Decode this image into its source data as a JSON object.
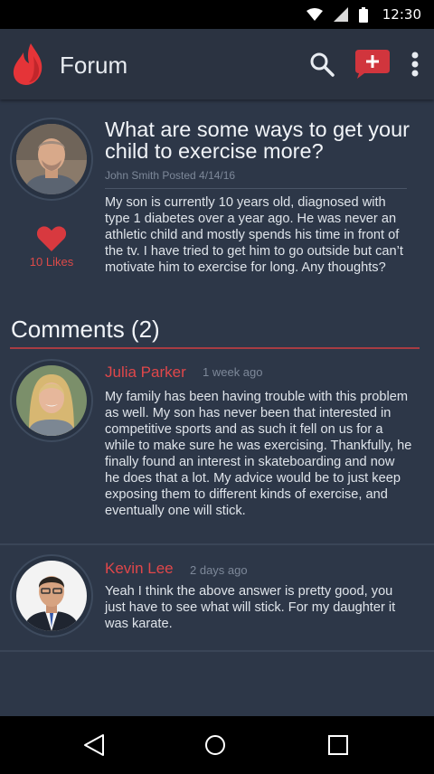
{
  "status_bar": {
    "time": "12:30",
    "icons": [
      "wifi-icon",
      "signal-icon",
      "battery-icon"
    ]
  },
  "app_bar": {
    "title": "Forum",
    "logo": "flame-logo",
    "actions": [
      "search-icon",
      "compose-icon",
      "more-vert-icon"
    ]
  },
  "question": {
    "title": "What are some ways to get your child to exercise more?",
    "author": "John Smith",
    "meta": "John Smith Posted 4/14/16",
    "body": "My son is currently 10 years old, diagnosed with type 1 diabetes over a year ago. He was never an athletic child and mostly spends his time in front of the tv. I have tried to get him to go outside but can’t motivate him to exercise for long. Any thoughts?",
    "likes_label": "10 Likes"
  },
  "comments": {
    "header": "Comments (2)",
    "items": [
      {
        "name": "Julia Parker",
        "time": "1 week ago",
        "body": "My family has been having trouble with this problem as well. My son has never been that interested in competitive sports and as such it fell on us for a while to make sure he was exercising. Thankfully, he finally found an interest in skateboarding and now he does that a lot. My advice would be to just keep exposing them to different kinds of exercise, and eventually one will stick."
      },
      {
        "name": "Kevin Lee",
        "time": "2 days ago",
        "body": "Yeah I think the above answer is pretty good, you just have to see what will stick. For my daughter it was karate."
      }
    ]
  },
  "nav_bar": {
    "buttons": [
      "back-icon",
      "home-icon",
      "recents-icon"
    ]
  },
  "colors": {
    "background": "#2d3748",
    "app_bar": "#2b3341",
    "accent": "#e0474a",
    "status_bar": "#000000"
  }
}
